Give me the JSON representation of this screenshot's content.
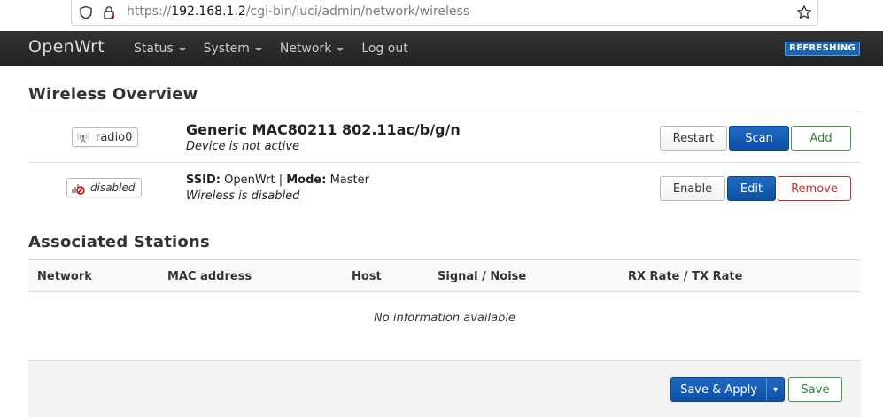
{
  "browser": {
    "url_scheme": "https://",
    "url_host": "192.168.1.2",
    "url_path": "/cgi-bin/luci/admin/network/wireless"
  },
  "header": {
    "brand": "OpenWrt",
    "nav": [
      {
        "label": "Status",
        "has_menu": true
      },
      {
        "label": "System",
        "has_menu": true
      },
      {
        "label": "Network",
        "has_menu": true
      },
      {
        "label": "Log out",
        "has_menu": false
      }
    ],
    "status_badge": "REFRESHING"
  },
  "wireless": {
    "title": "Wireless Overview",
    "radio": {
      "badge": "radio0",
      "name": "Generic MAC80211 802.11ac/b/g/n",
      "status": "Device is not active",
      "buttons": [
        "Restart",
        "Scan",
        "Add"
      ]
    },
    "network": {
      "badge": "disabled",
      "ssid_label": "SSID:",
      "ssid": "OpenWrt",
      "separator": "|",
      "mode_label": "Mode:",
      "mode": "Master",
      "status": "Wireless is disabled",
      "buttons": [
        "Enable",
        "Edit",
        "Remove"
      ]
    }
  },
  "stations": {
    "title": "Associated Stations",
    "columns": [
      "Network",
      "MAC address",
      "Host",
      "Signal / Noise",
      "RX Rate / TX Rate"
    ],
    "empty_text": "No information available"
  },
  "footer": {
    "save_apply": "Save & Apply",
    "dropdown_glyph": "▾",
    "save": "Save"
  },
  "colors": {
    "primary": "#0d4fa3",
    "success": "#2a8a3a",
    "danger": "#c9302c",
    "header_bg": "#222222",
    "badge_bg": "#1b64b4"
  }
}
